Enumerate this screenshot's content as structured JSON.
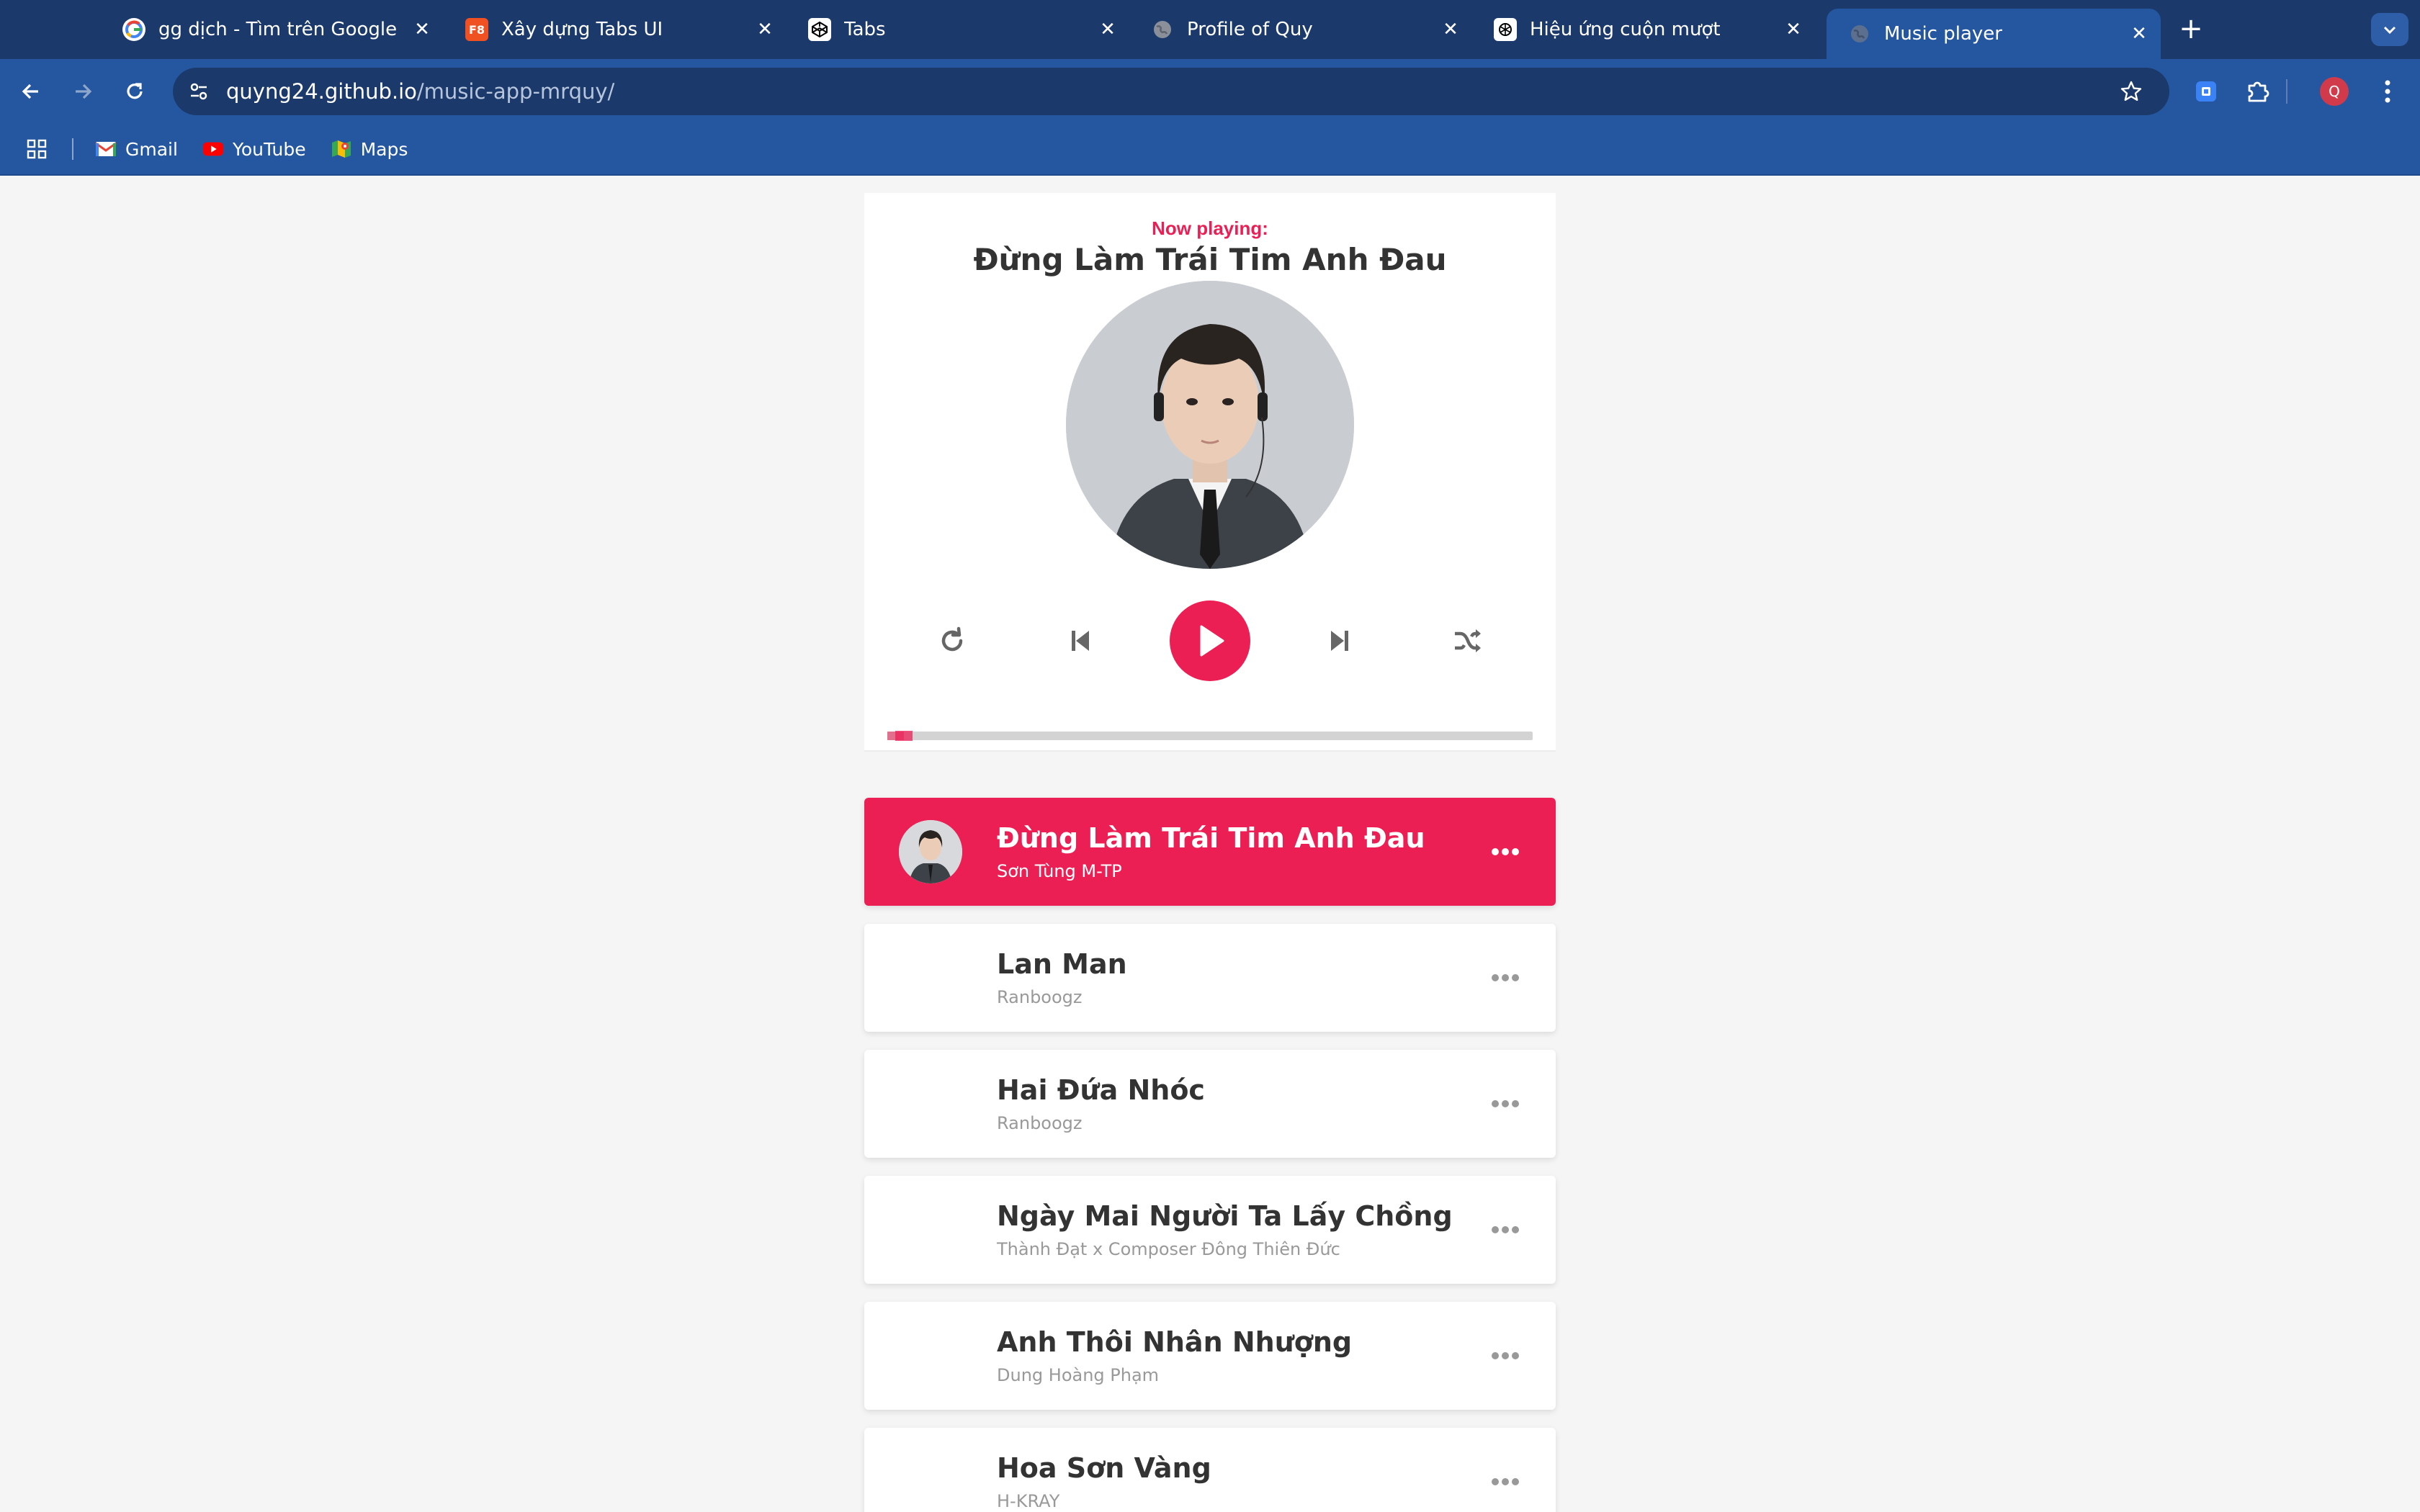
{
  "browser": {
    "tabs": [
      {
        "title": "gg dịch - Tìm trên Google",
        "icon": "google-icon"
      },
      {
        "title": "Xây dựng Tabs UI",
        "icon": "f8-icon",
        "icon_text": "F8"
      },
      {
        "title": "Tabs",
        "icon": "codepen-icon"
      },
      {
        "title": "Profile of Quy",
        "icon": "globe-icon"
      },
      {
        "title": "Hiệu ứng cuộn mượt",
        "icon": "chatgpt-icon"
      },
      {
        "title": "Music player",
        "icon": "globe-icon"
      }
    ],
    "active_tab": 5,
    "url_host": "quyng24.github.io",
    "url_path": "/music-app-mrquy/",
    "profile_initial": "Q",
    "bookmarks": [
      {
        "label": "Gmail",
        "icon": "gmail-icon"
      },
      {
        "label": "YouTube",
        "icon": "youtube-icon"
      },
      {
        "label": "Maps",
        "icon": "maps-icon"
      }
    ],
    "colors": {
      "tabstrip": "#1b3a6b",
      "toolbar": "#2557a0"
    }
  },
  "player": {
    "now_playing_label": "Now playing:",
    "current_song": "Đừng Làm Trái Tim Anh Đau",
    "progress": 0.026,
    "accent": "#ec1f55",
    "controls": [
      "repeat-icon",
      "prev-icon",
      "play-icon",
      "next-icon",
      "shuffle-icon"
    ]
  },
  "playlist": [
    {
      "title": "Đừng Làm Trái Tim Anh Đau",
      "author": "Sơn Tùng M-TP",
      "active": true
    },
    {
      "title": "Lan Man",
      "author": "Ranboogz",
      "active": false
    },
    {
      "title": "Hai Đứa Nhóc",
      "author": "Ranboogz",
      "active": false
    },
    {
      "title": "Ngày Mai Người Ta Lấy Chồng",
      "author": "Thành Đạt x Composer Đông Thiên Đức",
      "active": false
    },
    {
      "title": "Anh Thôi Nhân Nhượng",
      "author": "Dung Hoàng Phạm",
      "active": false
    },
    {
      "title": "Hoa Sơn Vàng",
      "author": "H-KRAY",
      "active": false
    }
  ]
}
